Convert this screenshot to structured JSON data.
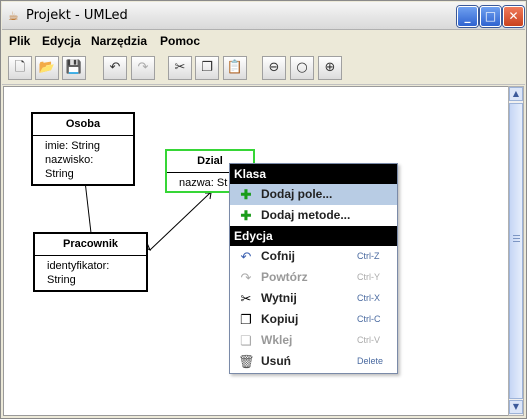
{
  "window": {
    "title": "Projekt - UMLed"
  },
  "menubar": {
    "items": [
      "Plik",
      "Edycja",
      "Narzędzia",
      "Pomoc"
    ]
  },
  "toolbar": {
    "buttons": [
      {
        "icon": "new-file-icon",
        "glyph": "🗋"
      },
      {
        "icon": "open-folder-icon",
        "glyph": "📂"
      },
      {
        "icon": "save-icon",
        "glyph": "💾"
      },
      {
        "icon": "undo-icon",
        "glyph": "↶"
      },
      {
        "icon": "redo-icon",
        "glyph": "↷"
      },
      {
        "icon": "cut-icon",
        "glyph": "✂"
      },
      {
        "icon": "copy-icon",
        "glyph": "❐"
      },
      {
        "icon": "paste-icon",
        "glyph": "📋"
      },
      {
        "icon": "zoom-out-icon",
        "glyph": "⊖"
      },
      {
        "icon": "zoom-reset-icon",
        "glyph": "○"
      },
      {
        "icon": "zoom-in-icon",
        "glyph": "⊕"
      }
    ]
  },
  "diagram": {
    "classes": [
      {
        "name": "Osoba",
        "attrs": [
          "imie: String",
          "nazwisko: String"
        ]
      },
      {
        "name": "Dzial",
        "attrs": [
          "nazwa: St"
        ]
      },
      {
        "name": "Pracownik",
        "attrs": [
          "identyfikator: String"
        ]
      }
    ]
  },
  "context_menu": {
    "sections": [
      {
        "title": "Klasa",
        "items": [
          {
            "label": "Dodaj pole...",
            "icon": "plus-icon",
            "shortcut": ""
          },
          {
            "label": "Dodaj metode...",
            "icon": "plus-icon",
            "shortcut": ""
          }
        ]
      },
      {
        "title": "Edycja",
        "items": [
          {
            "label": "Cofnij",
            "icon": "undo-icon",
            "shortcut": "Ctrl-Z"
          },
          {
            "label": "Powtórz",
            "icon": "redo-icon",
            "shortcut": "Ctrl-Y"
          },
          {
            "label": "Wytnij",
            "icon": "cut-icon",
            "shortcut": "Ctrl-X"
          },
          {
            "label": "Kopiuj",
            "icon": "copy-icon",
            "shortcut": "Ctrl-C"
          },
          {
            "label": "Wklej",
            "icon": "paste-icon",
            "shortcut": "Ctrl-V"
          },
          {
            "label": "Usuń",
            "icon": "trash-icon",
            "shortcut": "Delete"
          }
        ]
      }
    ]
  },
  "colors": {
    "selected_border": "#36d636",
    "menu_header": "#000000",
    "highlight": "#b8cce4",
    "shortcut_text": "#4a6aa0"
  }
}
